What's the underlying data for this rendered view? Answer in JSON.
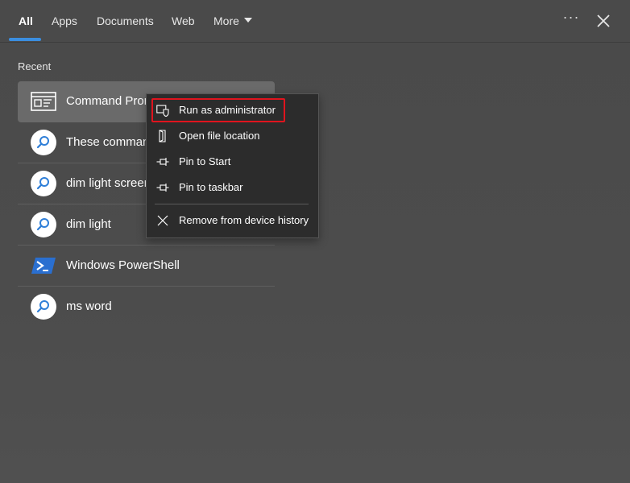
{
  "tabs": [
    {
      "label": "All",
      "active": true
    },
    {
      "label": "Apps",
      "active": false
    },
    {
      "label": "Documents",
      "active": false
    },
    {
      "label": "Web",
      "active": false
    },
    {
      "label": "More",
      "active": false
    }
  ],
  "top_actions": {
    "ellipsis": "···"
  },
  "section": {
    "title": "Recent"
  },
  "recent_items": [
    {
      "label": "Command Prompt",
      "icon": "command-prompt-icon",
      "selected": true
    },
    {
      "label": "These commands",
      "icon": "search-icon",
      "selected": false
    },
    {
      "label": "dim light screen",
      "icon": "search-icon",
      "selected": false
    },
    {
      "label": "dim light",
      "icon": "search-icon",
      "selected": false
    },
    {
      "label": "Windows PowerShell",
      "icon": "powershell-icon",
      "selected": false
    },
    {
      "label": "ms word",
      "icon": "search-icon",
      "selected": false
    }
  ],
  "context_menu": {
    "items": [
      {
        "label": "Run as administrator",
        "icon": "shield-icon",
        "highlighted": true
      },
      {
        "label": "Open file location",
        "icon": "folder-icon"
      },
      {
        "label": "Pin to Start",
        "icon": "pin-icon"
      },
      {
        "label": "Pin to taskbar",
        "icon": "pin-icon"
      },
      {
        "label": "Remove from device history",
        "icon": "close-icon"
      }
    ]
  },
  "colors": {
    "background": "#4b4b4b",
    "accent": "#3b8ee0",
    "highlight_border": "#e0141e",
    "menu_bg": "#2c2c2c"
  }
}
